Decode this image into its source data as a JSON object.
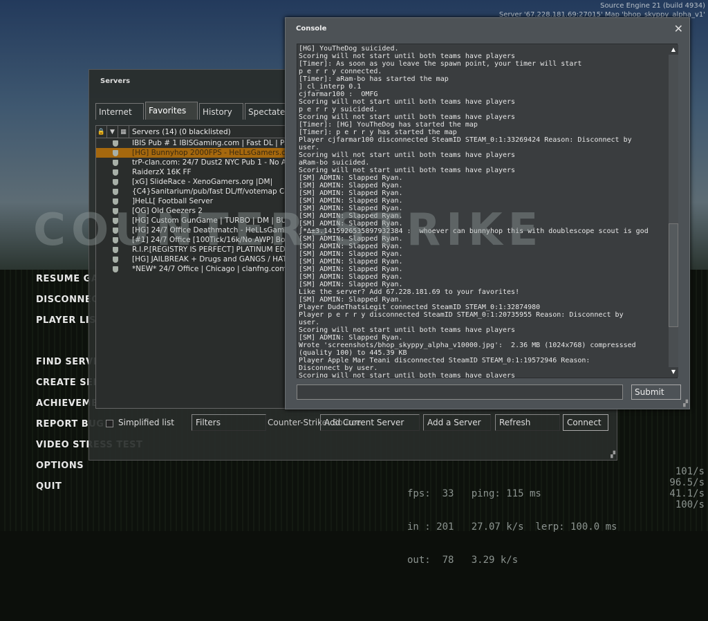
{
  "engine": {
    "version": "Source Engine 21 (build 4934)",
    "server": "Server '67.228.181.69:27015' Map 'bhop_skyppy_alpha_v1'"
  },
  "logo": "COUNTER-STRIKE",
  "menu": [
    "RESUME GAME",
    "DISCONNECT",
    "PLAYER LIST",
    "FIND SERVERS",
    "CREATE SERVER",
    "ACHIEVEMENTS",
    "REPORT BUG",
    "VIDEO STRESS TEST",
    "OPTIONS",
    "QUIT"
  ],
  "servers": {
    "title": "Servers",
    "tabs": [
      "Internet",
      "Favorites",
      "History",
      "Spectate"
    ],
    "active_tab": "Favorites",
    "header": "Servers (14) (0 blacklisted)",
    "rows": [
      "IBIS Pub # 1 IBISGaming.com | Fast DL | Psycho",
      "[HG] Bunnyhop 2000FPS - HeLLsGamers.com [10",
      "trP-clan.com: 24/7 Dust2 NYC Pub 1 - No AWPs/",
      "RaiderzX 16K FF",
      "[xG] SlideRace - XenoGamers.org |DM|",
      "{C4}Sanitarium/pub/fast DL/ff/votemap Cerebral",
      "]HeLL[ Football Server",
      "[OG] Old Geezers 2",
      "[HG] Custom GunGame | TURBO | DM | BUYLEV",
      "[HG] 24/7 Office Deathmatch - HeLLsGamers.com",
      "[#1] 24/7 Office [100Tick/16k/No AWP] BoSS-Ga",
      "R.I.P.[REGISTRY IS PERFECT] PLATINUM EDITI",
      "[HG] JAILBREAK + Drugs and GANGS / HATS / I",
      "*NEW* 24/7 Office | Chicago | clanfng.com | No"
    ],
    "selected_row": 1,
    "simplified_list": "Simplified list",
    "filters": "Filters",
    "game": "Counter-Strike: Source",
    "add_current": "Add Current Server",
    "add_server": "Add a Server",
    "refresh": "Refresh",
    "connect": "Connect"
  },
  "console": {
    "title": "Console",
    "close": "✕",
    "submit": "Submit",
    "input": "",
    "lines": [
      "[HG] YouTheDog suicided.",
      "Scoring will not start until both teams have players",
      "[Timer]: As soon as you leave the spawn point, your timer will start",
      "p e r r y connected.",
      "[Timer]: aRam-bo has started the map",
      "] cl_interp 0.1",
      "cjfarmar100 :  OMFG",
      "Scoring will not start until both teams have players",
      "p e r r y suicided.",
      "Scoring will not start until both teams have players",
      "[Timer]: [HG] YouTheDog has started the map",
      "[Timer]: p e r r y has started the map",
      "Player cjfarmar100 disconnected SteamID STEAM_0:1:33269424 Reason: Disconnect by",
      "user.",
      "Scoring will not start until both teams have players",
      "aRam-bo suicided.",
      "Scoring will not start until both teams have players",
      "[SM] ADMIN: Slapped Ryan.",
      "[SM] ADMIN: Slapped Ryan.",
      "[SM] ADMIN: Slapped Ryan.",
      "[SM] ADMIN: Slapped Ryan.",
      "[SM] ADMIN: Slapped Ryan.",
      "[SM] ADMIN: Slapped Ryan.",
      "[SM] ADMIN: Slapped Ryan.",
      "∫*∆±3.14159265358979323​84 :  whoever can bunnyhop this with doublescope scout is god",
      "[SM] ADMIN: Slapped Ryan.",
      "[SM] ADMIN: Slapped Ryan.",
      "[SM] ADMIN: Slapped Ryan.",
      "[SM] ADMIN: Slapped Ryan.",
      "[SM] ADMIN: Slapped Ryan.",
      "[SM] ADMIN: Slapped Ryan.",
      "[SM] ADMIN: Slapped Ryan.",
      "Like the server? Add 67.228.181.69 to your favorites!",
      "[SM] ADMIN: Slapped Ryan.",
      "Player DudeThatsLegit connected SteamID STEAM_0:1:32874980",
      "Player p e r r y disconnected SteamID STEAM_0:1:20735955 Reason: Disconnect by",
      "user.",
      "Scoring will not start until both teams have players",
      "[SM] ADMIN: Slapped Ryan.",
      "Wrote 'screenshots/bhop_skyppy_alpha_v10000.jpg':  2.36 MB (1024x768) compresssed",
      "(quality 100) to 445.39 KB",
      "Player Apple Mar Teani disconnected SteamID STEAM_0:1:19572946 Reason:",
      "Disconnect by user.",
      "Scoring will not start until both teams have players"
    ]
  },
  "netgraph": {
    "l1": "fps:  33   ping: 115 ms",
    "l2": "in : 201   27.07 k/s  lerp: 100.0 ms",
    "l3": "out:  78   3.29 k/s",
    "r1": "101/s",
    "r2": "96.5/s",
    "r3": "41.1/s",
    "r4": "100/s"
  }
}
